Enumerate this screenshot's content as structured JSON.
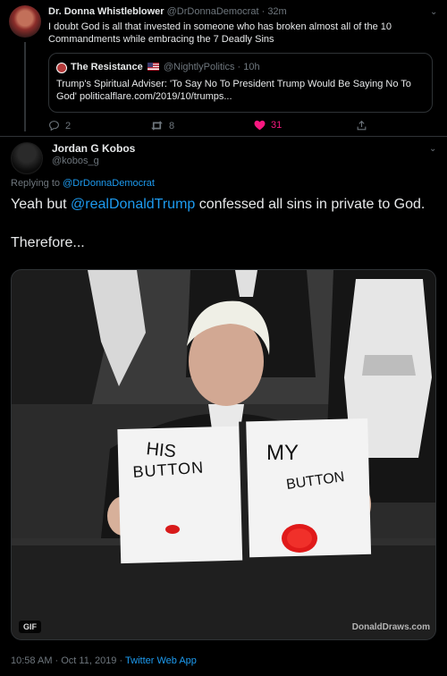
{
  "top_tweet": {
    "author_name": "Dr. Donna Whistleblower",
    "author_handle": "@DrDonnaDemocrat",
    "time": "32m",
    "text": "I doubt God is all that invested in someone who has broken almost all of the 10 Commandments while embracing the 7 Deadly Sins",
    "quote": {
      "author_name": "The Resistance",
      "author_handle": "@NightlyPolitics",
      "time": "10h",
      "text": "Trump's Spiritual Adviser: 'To Say No To President Trump Would Be Saying No To God' politicalflare.com/2019/10/trumps..."
    },
    "actions": {
      "replies": "2",
      "retweets": "8",
      "likes": "31"
    }
  },
  "main_tweet": {
    "author_name": "Jordan G Kobos",
    "author_handle": "@kobos_g",
    "replying_prefix": "Replying to",
    "replying_to": "@DrDonnaDemocrat",
    "text_before": "Yeah but",
    "mention": "@realDonaldTrump",
    "text_after": "confessed all sins in private to God.",
    "text_line2": "Therefore...",
    "media": {
      "badge": "GIF",
      "sign_left_line1": "HIS",
      "sign_left_line2": "BUTTON",
      "sign_right_line1": "MY",
      "sign_right_line2": "BUTTON",
      "watermark": "DonaldDraws.com"
    },
    "timestamp": "10:58 AM · Oct 11, 2019 ·",
    "source": "Twitter Web App"
  },
  "colors": {
    "link": "#1d9bf0",
    "like": "#f91880",
    "muted": "#6e767d",
    "background": "#000000"
  },
  "icons": [
    "reply-icon",
    "retweet-icon",
    "like-icon",
    "share-icon",
    "chevron-down-icon"
  ]
}
